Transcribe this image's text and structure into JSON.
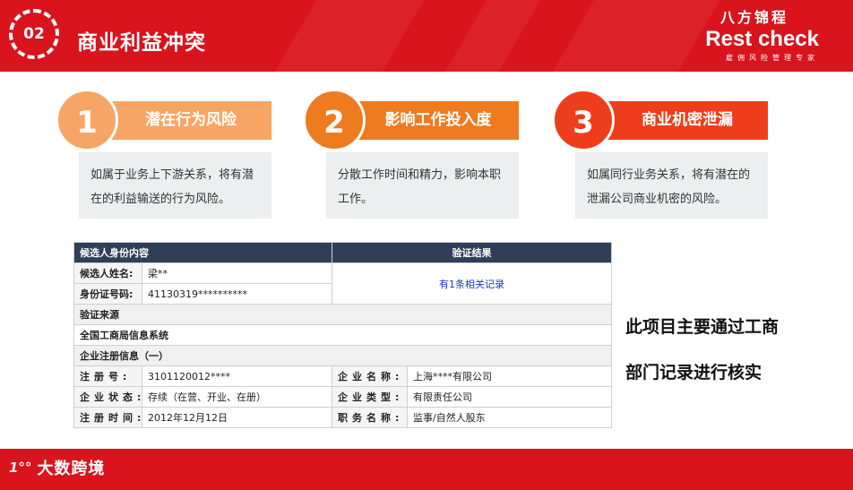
{
  "header": {
    "number": "02",
    "title": "商业利益冲突",
    "brand_cn": "八方锦程",
    "brand_en": "Rest check",
    "brand_tagline": "雇佣风险管理专家",
    "color": "#d9141d"
  },
  "cards": [
    {
      "number": "1",
      "title": "潜在行为风险",
      "text": "如属于业务上下游关系，将有潜在的利益输送的行为风险。",
      "color": "#f7a564"
    },
    {
      "number": "2",
      "title": "影响工作投入度",
      "text": "分散工作时间和精力，影响本职工作。",
      "color": "#ee7b1f"
    },
    {
      "number": "3",
      "title": "商业机密泄漏",
      "text": "如属同行业务关系，将有潜在的泄漏公司商业机密的风险。",
      "color": "#ee3d1a"
    }
  ],
  "table": {
    "header_left": "候选人身份内容",
    "header_right": "验证结果",
    "name_label": "候选人姓名:",
    "name_value": "梁**",
    "id_label": "身份证号码:",
    "id_value": "41130319**********",
    "result": "有1条相关记录",
    "source_label": "验证来源",
    "source_value": "全国工商局信息系统",
    "reg_label": "企业注册信息（一）",
    "rows": [
      {
        "l1": "注册号:",
        "v1": "3101120012****",
        "l2": "企业名称:",
        "v2": "上海****有限公司"
      },
      {
        "l1": "企业状态:",
        "v1": "存续（在营、开业、在册）",
        "l2": "企业类型:",
        "v2": "有限责任公司"
      },
      {
        "l1": "注册时间:",
        "v1": "2012年12月12日",
        "l2": "职务名称:",
        "v2": "监事/自然人股东"
      }
    ]
  },
  "side_note": {
    "line1": "此项目主要通过工商",
    "line2": "部门记录进行核实"
  },
  "footer": {
    "mark": "1°°",
    "text": "大数跨境"
  }
}
